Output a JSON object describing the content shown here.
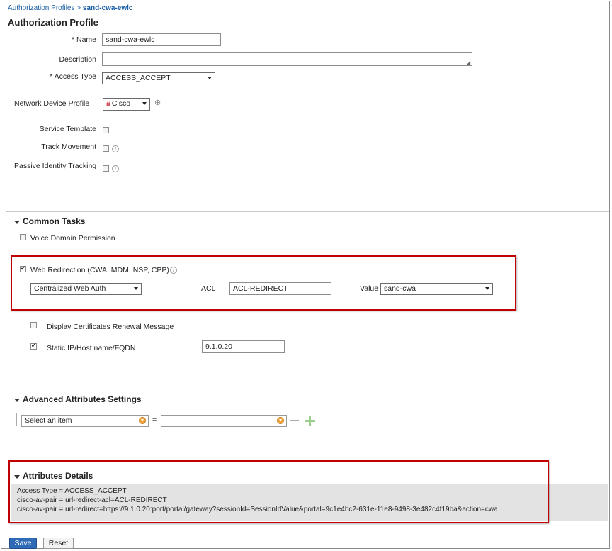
{
  "breadcrumb": {
    "parent": "Authorization Profiles",
    "separator": ">",
    "current": "sand-cwa-ewlc"
  },
  "page_title": "Authorization Profile",
  "form": {
    "name_label": "* Name",
    "name_value": "sand-cwa-ewlc",
    "description_label": "Description",
    "description_value": "",
    "access_type_label": "* Access Type",
    "access_type_value": "ACCESS_ACCEPT",
    "network_device_profile_label": "Network Device Profile",
    "network_device_profile_value": "Cisco",
    "service_template_label": "Service Template",
    "track_movement_label": "Track Movement",
    "passive_identity_label": "Passive Identity Tracking"
  },
  "common_tasks": {
    "title": "Common Tasks",
    "voice_domain_label": "Voice Domain Permission",
    "web_redirection_label": "Web Redirection (CWA, MDM, NSP, CPP)",
    "web_redirection_checked": true,
    "redirect_type_value": "Centralized Web Auth",
    "acl_label": "ACL",
    "acl_value": "ACL-REDIRECT",
    "value_label": "Value",
    "value_value": "sand-cwa",
    "display_cert_label": "Display Certificates Renewal Message",
    "static_ip_label": "Static IP/Host name/FQDN",
    "static_ip_checked": true,
    "static_ip_value": "9.1.0.20"
  },
  "advanced": {
    "title": "Advanced Attributes Settings",
    "select_placeholder": "Select an item",
    "equals": "=",
    "value": ""
  },
  "details": {
    "title": "Attributes Details",
    "lines": [
      "Access Type = ACCESS_ACCEPT",
      "cisco-av-pair = url-redirect-acl=ACL-REDIRECT",
      "cisco-av-pair = url-redirect=https://9.1.0.20:port/portal/gateway?sessionId=SessionIdValue&portal=9c1e4bc2-631e-11e8-9498-3e482c4f19ba&action=cwa"
    ]
  },
  "buttons": {
    "save": "Save",
    "reset": "Reset"
  },
  "colors": {
    "highlight": "#c00000",
    "link": "#1a5fa6",
    "save_button": "#2f6ab7"
  }
}
